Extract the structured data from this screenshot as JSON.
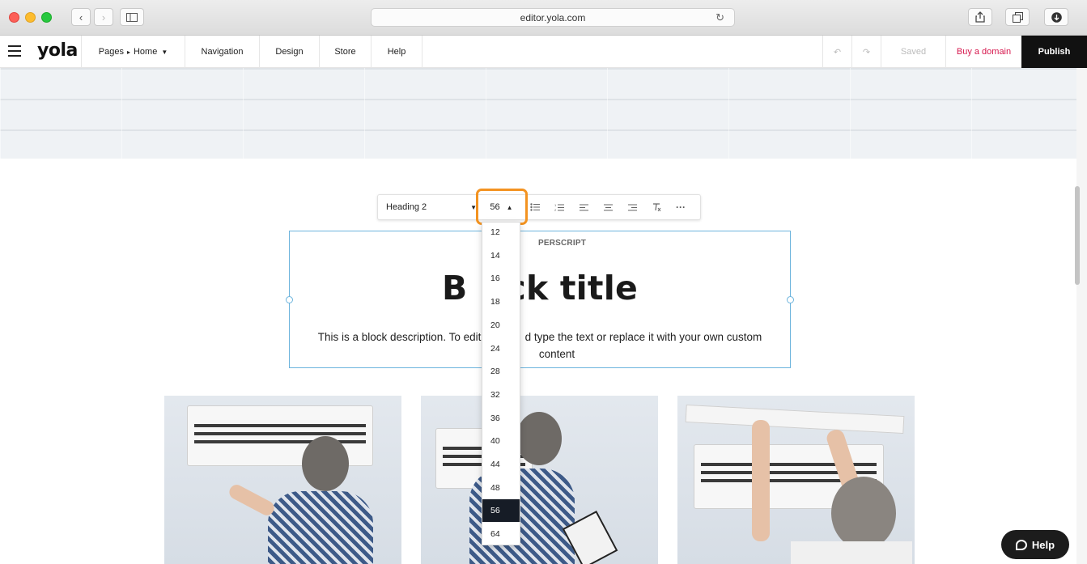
{
  "browser": {
    "url": "editor.yola.com"
  },
  "topbar": {
    "logo": "yola",
    "pages_label": "Pages",
    "breadcrumb_sep": "▸",
    "current_page": "Home",
    "navigation_label": "Navigation",
    "design_label": "Design",
    "store_label": "Store",
    "help_label": "Help",
    "saved_label": "Saved",
    "buy_domain_label": "Buy a domain",
    "publish_label": "Publish"
  },
  "format_toolbar": {
    "heading_style": "Heading 2",
    "font_size": "56",
    "more_label": "···"
  },
  "font_size_dropdown": {
    "options": [
      "12",
      "14",
      "16",
      "18",
      "20",
      "24",
      "28",
      "32",
      "36",
      "40",
      "44",
      "48",
      "56",
      "64"
    ],
    "selected": "56"
  },
  "block": {
    "superscript_visible": "PERSCRIPT",
    "title_left": "B",
    "title_right": "ck title",
    "description_left": "This is a block description. To edit, c",
    "description_right": "d type the text or replace it with your own custom",
    "description_line2": "content"
  },
  "help_widget": {
    "label": "Help"
  },
  "colors": {
    "accent_orange": "#f39321",
    "buy_domain": "#d6184e",
    "block_outline": "#6cb4dd",
    "selected_option": "#161c26"
  }
}
